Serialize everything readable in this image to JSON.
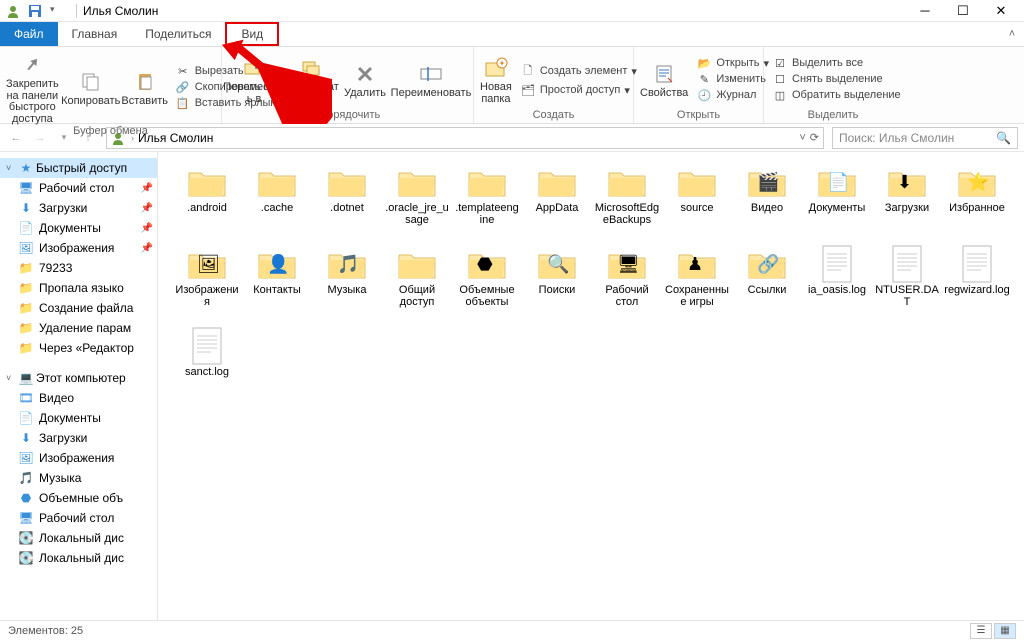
{
  "title": "Илья Смолин",
  "tabs": {
    "file": "Файл",
    "home": "Главная",
    "share": "Поделиться",
    "view": "Вид"
  },
  "ribbon": {
    "pin": "Закрепить на панели\nбыстрого доступа",
    "copy": "Копировать",
    "paste": "Вставить",
    "cut": "Вырезать",
    "copypath": "Скопировать путь",
    "pasteshortcut": "Вставить ярлык",
    "clipboard": "Буфер обмена",
    "moveto": "Переместит\nь в",
    "copyto": "Копироват\nь в",
    "delete": "Удалить",
    "rename": "Переименовать",
    "organize": "Упорядочить",
    "newfolder": "Новая\nпапка",
    "newitem": "Создать элемент",
    "easyaccess": "Простой доступ",
    "create": "Создать",
    "properties": "Свойства",
    "open": "Открыть",
    "edit": "Изменить",
    "history": "Журнал",
    "open_g": "Открыть",
    "selectall": "Выделить все",
    "selectnone": "Снять выделение",
    "invert": "Обратить выделение",
    "select_g": "Выделить"
  },
  "breadcrumb": "Илья Смолин",
  "search_placeholder": "Поиск: Илья Смолин",
  "sidebar": {
    "quick": "Быстрый доступ",
    "desktop": "Рабочий стол",
    "downloads": "Загрузки",
    "documents": "Документы",
    "pictures": "Изображения",
    "f79233": "79233",
    "propala": "Пропала языко",
    "sozdanie": "Создание файла",
    "udalenie": "Удаление парам",
    "cherez": "Через «Редактор",
    "thispc": "Этот компьютер",
    "video": "Видео",
    "docs2": "Документы",
    "dl2": "Загрузки",
    "pics2": "Изображения",
    "music": "Музыка",
    "objects3d": "Объемные объ",
    "desk2": "Рабочий стол",
    "localc": "Локальный дис",
    "locald": "Локальный дис"
  },
  "items": [
    {
      "name": ".android",
      "type": "folder"
    },
    {
      "name": ".cache",
      "type": "folder"
    },
    {
      "name": ".dotnet",
      "type": "folder"
    },
    {
      "name": ".oracle_jre_usage",
      "type": "folder"
    },
    {
      "name": ".templateengine",
      "type": "folder"
    },
    {
      "name": "AppData",
      "type": "folder"
    },
    {
      "name": "MicrosoftEdgeBackups",
      "type": "folder"
    },
    {
      "name": "source",
      "type": "folder"
    },
    {
      "name": "Видео",
      "type": "videos"
    },
    {
      "name": "Документы",
      "type": "documents"
    },
    {
      "name": "Загрузки",
      "type": "downloads"
    },
    {
      "name": "Избранное",
      "type": "favorites"
    },
    {
      "name": "Изображения",
      "type": "pictures"
    },
    {
      "name": "Контакты",
      "type": "contacts"
    },
    {
      "name": "Музыка",
      "type": "music"
    },
    {
      "name": "Общий доступ",
      "type": "folder"
    },
    {
      "name": "Объемные объекты",
      "type": "3d"
    },
    {
      "name": "Поиски",
      "type": "search"
    },
    {
      "name": "Рабочий стол",
      "type": "desktop"
    },
    {
      "name": "Сохраненные игры",
      "type": "games"
    },
    {
      "name": "Ссылки",
      "type": "links"
    },
    {
      "name": "ia_oasis.log",
      "type": "file"
    },
    {
      "name": "NTUSER.DAT",
      "type": "file"
    },
    {
      "name": "regwizard.log",
      "type": "file"
    },
    {
      "name": "sanct.log",
      "type": "file"
    }
  ],
  "status": "Элементов: 25"
}
